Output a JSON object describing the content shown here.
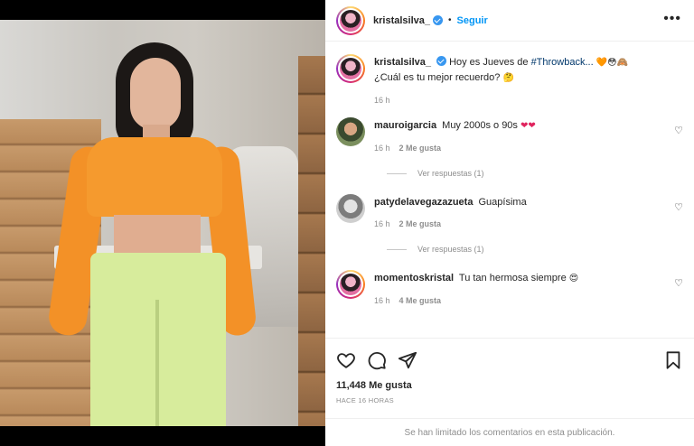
{
  "post": {
    "username": "kristalsilva_",
    "follow_label": "Seguir",
    "separator": "•",
    "more_label": "•••"
  },
  "caption": {
    "username": "kristalsilva_",
    "text_before_hashtag": "Hoy es Jueves de ",
    "hashtag": "#Throwback...",
    "emojis": "🧡😳🙈",
    "second_line": "¿Cuál es tu mejor recuerdo?",
    "second_emoji": "🤔",
    "time": "16 h"
  },
  "comments": [
    {
      "username": "mauroigarcia",
      "text": "Muy 2000s o 90s",
      "emoji": "❤❤",
      "time": "16 h",
      "likes": "2 Me gusta",
      "replies": "Ver respuestas (1)"
    },
    {
      "username": "patydelavegazazueta",
      "text": "Guapísima",
      "emoji": "",
      "time": "16 h",
      "likes": "2 Me gusta",
      "replies": "Ver respuestas (1)"
    },
    {
      "username": "momentoskristal",
      "text": "Tu tan hermosa siempre",
      "emoji": "😍",
      "time": "16 h",
      "likes": "4 Me gusta",
      "replies": ""
    }
  ],
  "actions": {
    "like_icon": "heart-icon",
    "comment_icon": "comment-icon",
    "share_icon": "paper-plane-icon",
    "save_icon": "bookmark-icon",
    "likes_count": "11,448 Me gusta",
    "posted_time": "HACE 16 HORAS",
    "comments_limited": "Se han limitado los comentarios en esta publicación."
  },
  "colors": {
    "accent": "#0095f6",
    "verified": "#3897f0",
    "muted": "#8e8e8e",
    "heart": "#e0245e"
  }
}
